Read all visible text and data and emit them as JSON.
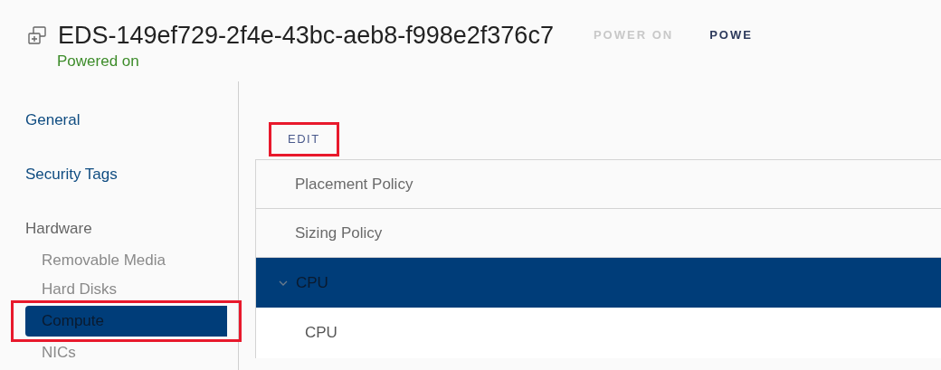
{
  "header": {
    "title": "EDS-149ef729-2f4e-43bc-aeb8-f998e2f376c7",
    "status": "Powered on",
    "actions": [
      {
        "label": "POWER ON",
        "disabled": true
      },
      {
        "label": "POWE",
        "disabled": false
      }
    ]
  },
  "sidebar": {
    "items": [
      {
        "label": "General",
        "selected": false
      },
      {
        "label": "Security Tags",
        "selected": false
      },
      {
        "label": "Hardware",
        "selected": false,
        "children": [
          {
            "label": "Removable Media",
            "selected": false
          },
          {
            "label": "Hard Disks",
            "selected": false
          },
          {
            "label": "Compute",
            "selected": true,
            "highlighted": true
          },
          {
            "label": "NICs",
            "selected": false
          }
        ]
      }
    ]
  },
  "edit_button": {
    "label": "EDIT",
    "highlighted": true
  },
  "stack": [
    {
      "kind": "row",
      "label": "Placement Policy"
    },
    {
      "kind": "row",
      "label": "Sizing Policy"
    },
    {
      "kind": "section",
      "label": "CPU",
      "expanded": true,
      "selected": true
    },
    {
      "kind": "subrow",
      "label": "CPU"
    }
  ]
}
